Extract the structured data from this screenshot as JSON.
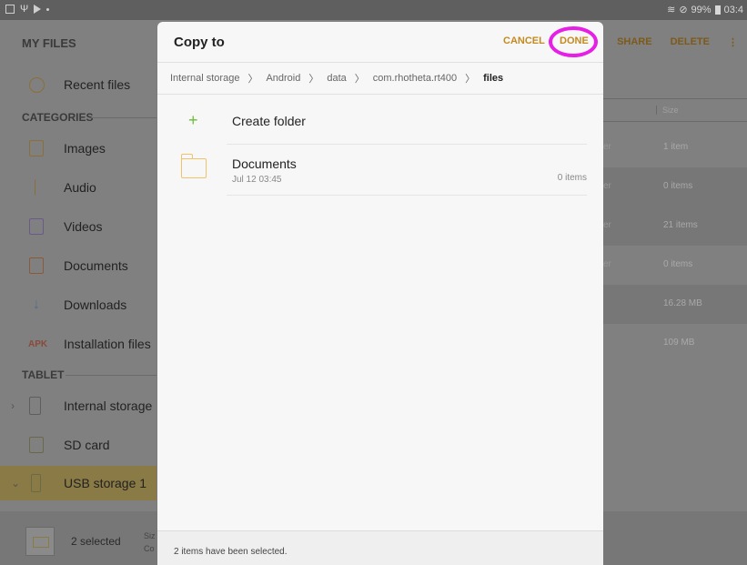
{
  "status_bar": {
    "right_text": "99%",
    "time": "03:4"
  },
  "app": {
    "title": "MY FILES",
    "actions": {
      "share": "SHARE",
      "delete": "DELETE",
      "more": "⋮"
    }
  },
  "sidebar": {
    "recent": "Recent files",
    "categories_header": "CATEGORIES",
    "categories": [
      "Images",
      "Audio",
      "Videos",
      "Documents",
      "Downloads",
      "Installation files"
    ],
    "apk_badge": "APK",
    "tablet_header": "TABLET",
    "storage": [
      "Internal storage",
      "SD card",
      "USB storage 1"
    ]
  },
  "right_pane": {
    "size_header": "Size",
    "rows": [
      {
        "type": "er",
        "size": "1 item"
      },
      {
        "type": "er",
        "size": "0 items"
      },
      {
        "type": "er",
        "size": "21 items"
      },
      {
        "type": "er",
        "size": "0 items"
      },
      {
        "type": "",
        "size": "16.28 MB"
      },
      {
        "type": "",
        "size": "109 MB"
      }
    ]
  },
  "bottom_bar": {
    "selected": "2 selected",
    "size_line1": "Siz",
    "size_line2": "Co"
  },
  "dialog": {
    "title": "Copy to",
    "cancel": "CANCEL",
    "done": "DONE",
    "breadcrumb": [
      "Internal storage",
      "Android",
      "data",
      "com.rhotheta.rt400",
      "files"
    ],
    "create_folder": "Create folder",
    "folders": [
      {
        "name": "Documents",
        "date": "Jul 12 03:45",
        "count": "0 items"
      }
    ],
    "footer": "2 items have been selected."
  },
  "colors": {
    "accent": "#c38a1f",
    "highlight_circle": "#e61ee6",
    "plus": "#6dbe3a",
    "folder": "#f0c36a"
  }
}
